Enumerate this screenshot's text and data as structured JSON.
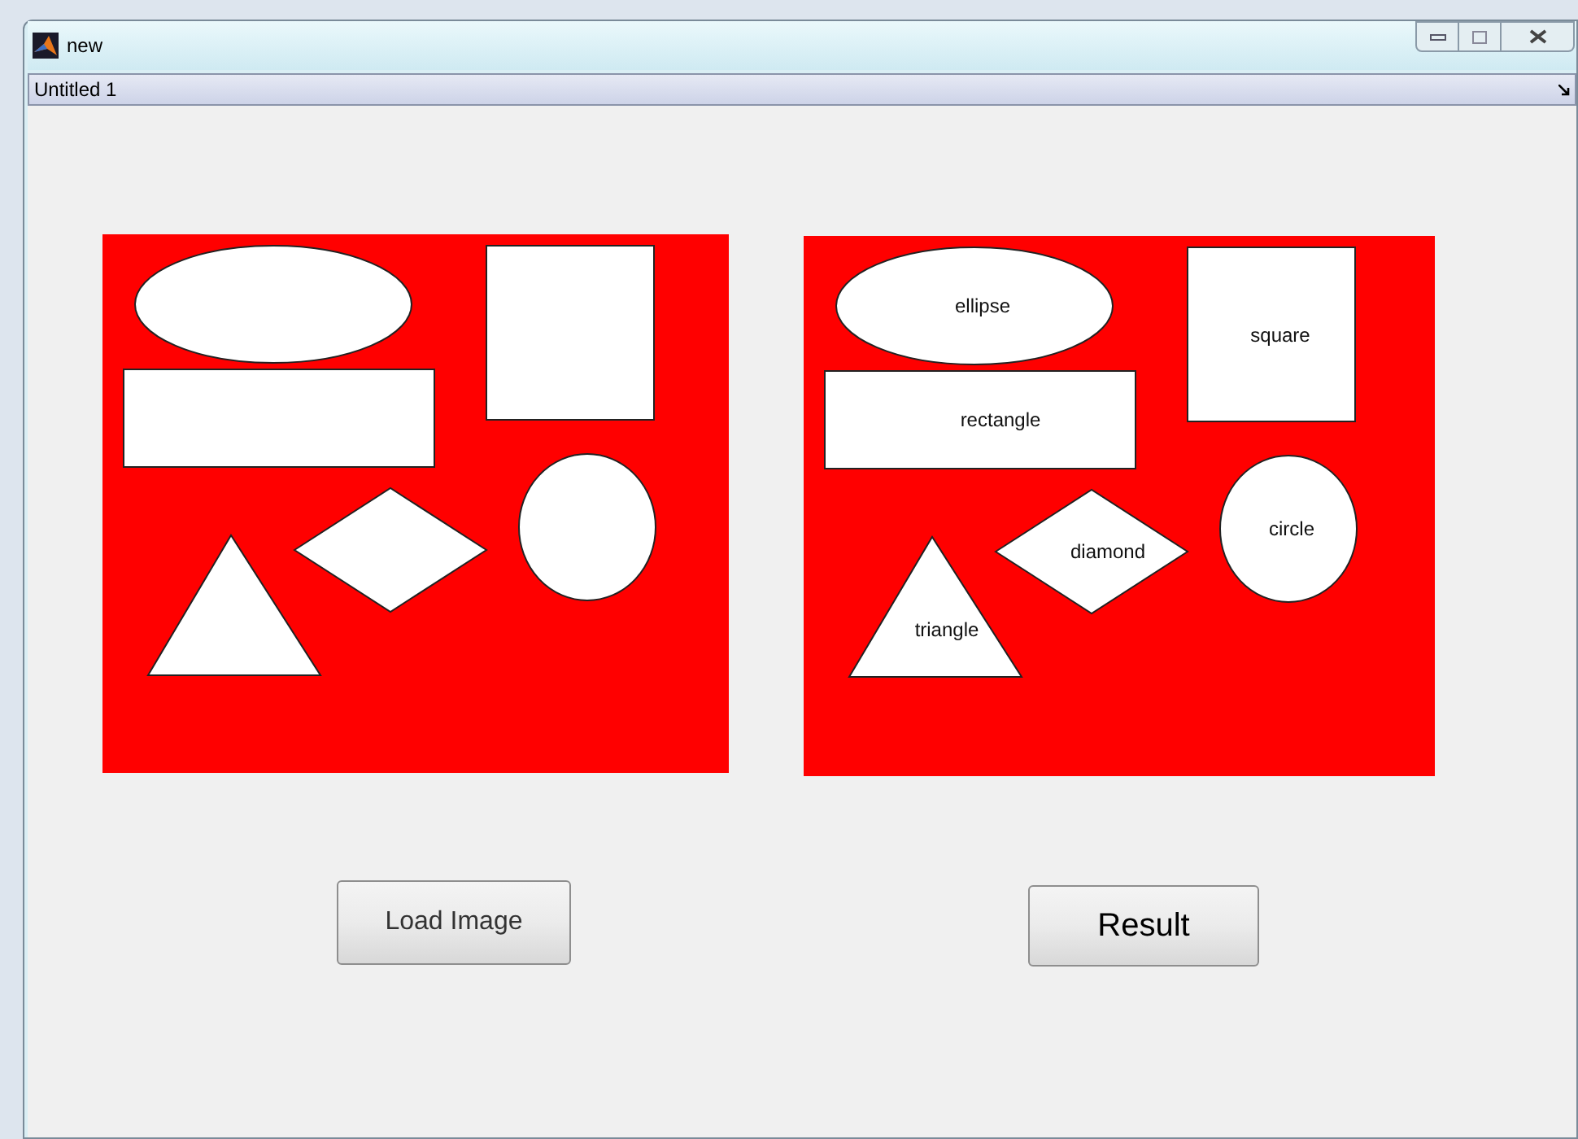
{
  "window": {
    "title": "new"
  },
  "document_bar": {
    "title": "Untitled 1"
  },
  "input_image": {
    "shapes": [
      {
        "kind": "ellipse"
      },
      {
        "kind": "rectangle"
      },
      {
        "kind": "square"
      },
      {
        "kind": "circle"
      },
      {
        "kind": "triangle"
      },
      {
        "kind": "diamond"
      }
    ]
  },
  "result_image": {
    "shapes": [
      {
        "kind": "ellipse",
        "label": "ellipse"
      },
      {
        "kind": "rectangle",
        "label": "rectangle"
      },
      {
        "kind": "square",
        "label": "square"
      },
      {
        "kind": "circle",
        "label": "circle"
      },
      {
        "kind": "diamond",
        "label": "diamond"
      },
      {
        "kind": "triangle",
        "label": "triangle"
      }
    ]
  },
  "buttons": [
    {
      "label": "Load Image",
      "kind": "normal"
    },
    {
      "label": "Result",
      "kind": "bold"
    }
  ]
}
